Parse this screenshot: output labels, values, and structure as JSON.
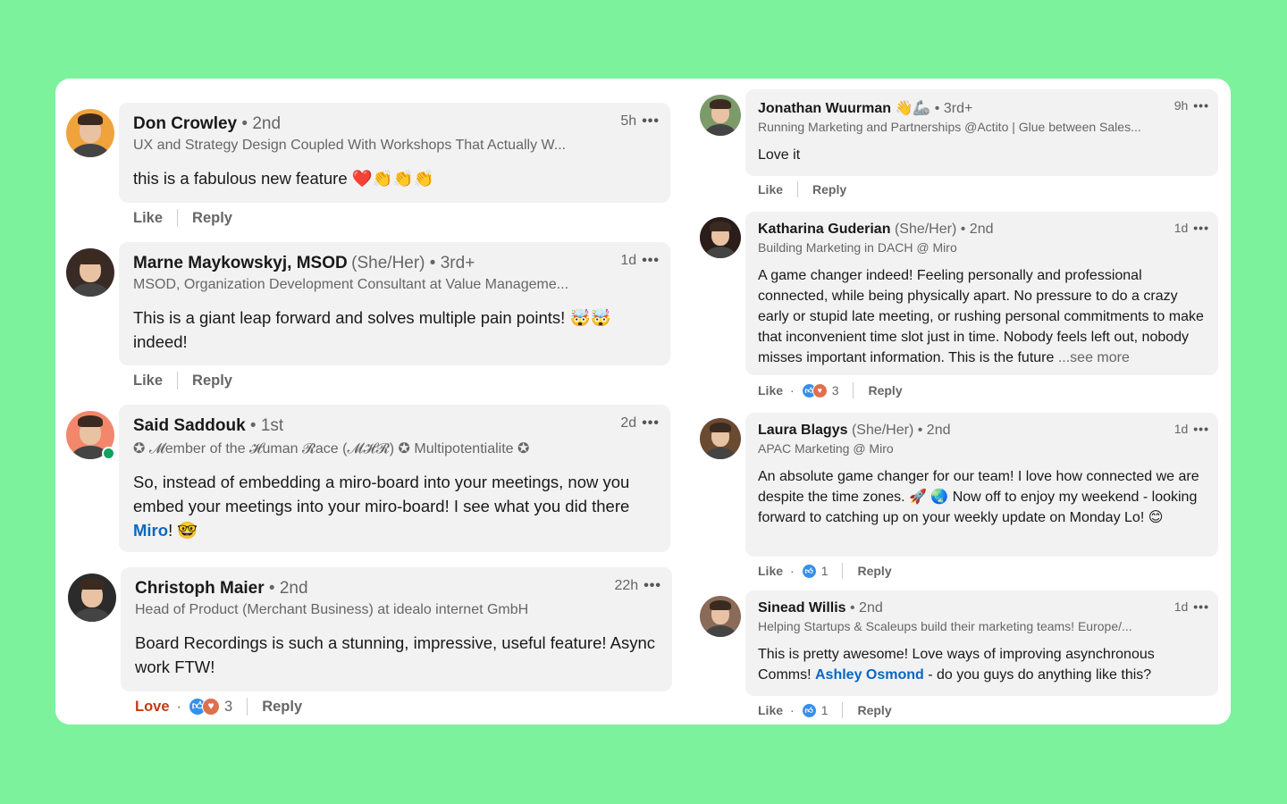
{
  "colors": {
    "background": "#7df29c",
    "link": "#0a66c2",
    "love": "#c23d14",
    "like_icon": "#378fe9",
    "love_icon": "#df704d"
  },
  "comments": [
    {
      "column": "left",
      "name": "Don Crowley",
      "pronouns": "",
      "degree": "2nd",
      "headline": "UX and Strategy Design Coupled With Workshops That Actually W...",
      "time": "5h",
      "body": [
        {
          "text": "this is a fabulous new feature ❤️👏👏👏"
        }
      ],
      "actions": {
        "like": "Like",
        "reply": "Reply"
      },
      "avatar_color": "#f0a33a"
    },
    {
      "column": "left",
      "name": "Marne Maykowskyj, MSOD",
      "pronouns": "(She/Her)",
      "degree": "3rd+",
      "headline": "MSOD, Organization Development Consultant at Value Manageme...",
      "time": "1d",
      "body": [
        {
          "text": "This is a giant leap forward and solves multiple pain points! 🤯🤯 indeed!"
        }
      ],
      "actions": {
        "like": "Like",
        "reply": "Reply"
      },
      "avatar_color": "#3a2a26"
    },
    {
      "column": "left",
      "name": "Said Saddouk",
      "pronouns": "",
      "degree": "1st",
      "headline": "✪ 𝓜ember of the 𝓗uman 𝓡ace (𝓜𝓗𝓡) ✪ Multipotentialite ✪",
      "time": "2d",
      "online": true,
      "body": [
        {
          "text": "So, instead of embedding a miro-board into your meetings, now you embed your meetings into your miro-board! I see what you did there "
        },
        {
          "link": "Miro"
        },
        {
          "text": "! 🤓"
        }
      ],
      "avatar_color": "#f3876b"
    },
    {
      "column": "left",
      "name": "Christoph Maier",
      "pronouns": "",
      "degree": "2nd",
      "headline": "Head of Product (Merchant Business) at idealo internet GmbH",
      "time": "22h",
      "body": [
        {
          "text": "Board Recordings is such a stunning, impressive, useful feature! Async work FTW!"
        }
      ],
      "actions": {
        "like": "Love",
        "like_active": true,
        "reactions": [
          "like",
          "love"
        ],
        "count": "3",
        "reply": "Reply"
      },
      "avatar_color": "#2b2b2b"
    },
    {
      "column": "right",
      "name": "Jonathan Wuurman 👋🦾",
      "pronouns": "",
      "degree": "3rd+",
      "headline": "Running Marketing and Partnerships @Actito | Glue between Sales...",
      "time": "9h",
      "body": [
        {
          "text": "Love it"
        }
      ],
      "actions": {
        "like": "Like",
        "reply": "Reply"
      },
      "avatar_color": "#7c9a6a"
    },
    {
      "column": "right",
      "name": "Katharina Guderian",
      "pronouns": "(She/Her)",
      "degree": "2nd",
      "headline": "Building Marketing in DACH @ Miro",
      "time": "1d",
      "body": [
        {
          "text": "A game changer indeed! Feeling personally and professional connected, while being physically apart. No pressure to do a crazy early or stupid late meeting, or rushing personal commitments to make that inconvenient time slot just in time. Nobody feels left out, nobody misses important information. This is the future  "
        },
        {
          "more": "...see more"
        }
      ],
      "actions": {
        "like": "Like",
        "reactions": [
          "like",
          "love"
        ],
        "count": "3",
        "reply": "Reply"
      },
      "avatar_color": "#2a1d1a"
    },
    {
      "column": "right",
      "name": "Laura Blagys",
      "pronouns": "(She/Her)",
      "degree": "2nd",
      "headline": "APAC Marketing @ Miro",
      "time": "1d",
      "body": [
        {
          "text": "An absolute game changer for our team! I love how connected we are despite the time zones. 🚀 🌏 Now off to enjoy my weekend - looking forward to catching up on your weekly update on Monday Lo! 😊"
        }
      ],
      "actions": {
        "like": "Like",
        "reactions": [
          "like"
        ],
        "count": "1",
        "reply": "Reply"
      },
      "avatar_color": "#6b4a32"
    },
    {
      "column": "right",
      "name": "Sinead Willis",
      "pronouns": "",
      "degree": "2nd",
      "headline": "Helping Startups & Scaleups build their marketing teams! Europe/...",
      "time": "1d",
      "body": [
        {
          "text": "This is pretty awesome! Love ways of improving asynchronous Comms! "
        },
        {
          "link": "Ashley Osmond"
        },
        {
          "text": " - do you guys do anything like this?"
        }
      ],
      "actions": {
        "like": "Like",
        "reactions": [
          "like"
        ],
        "count": "1",
        "reply": "Reply"
      },
      "avatar_color": "#8a6a58"
    }
  ]
}
